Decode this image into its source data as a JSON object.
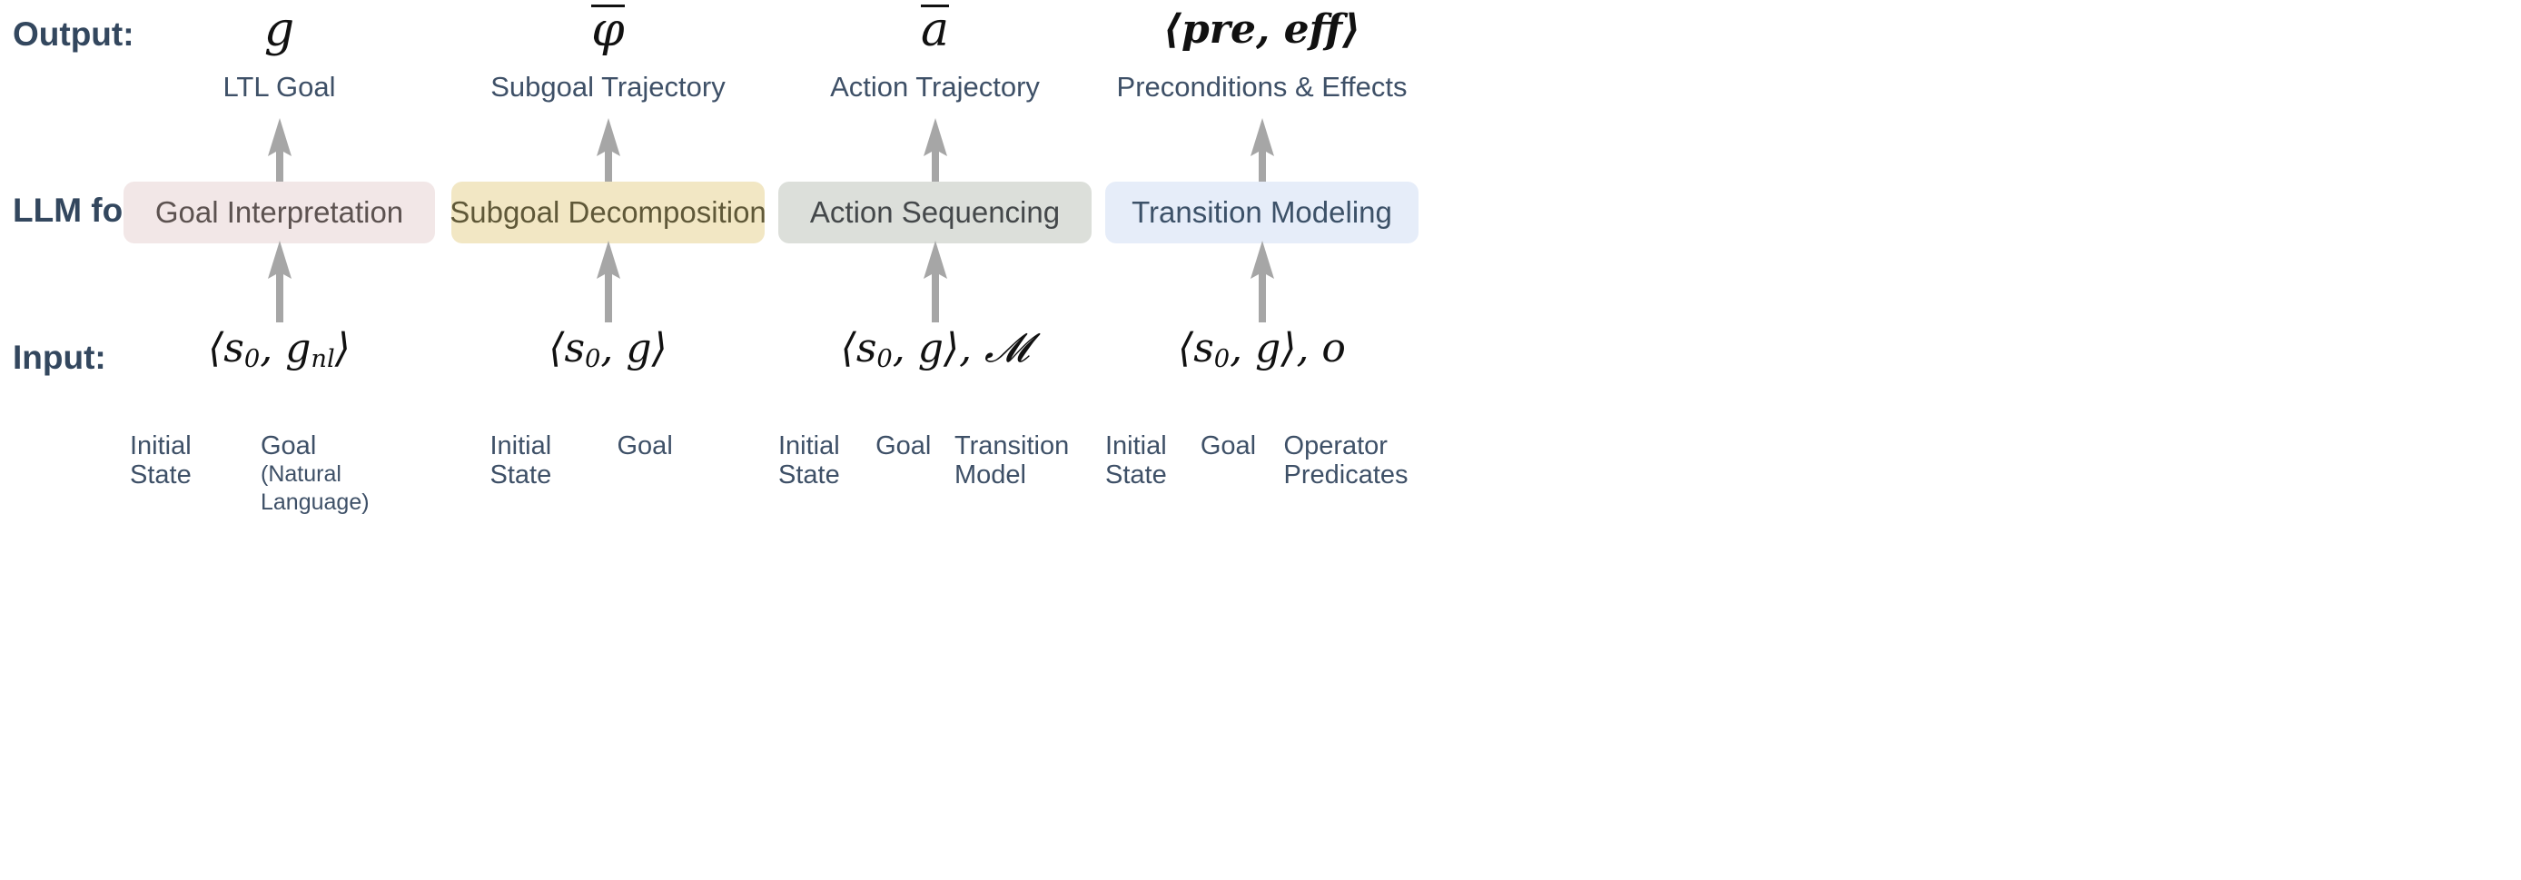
{
  "rows": {
    "output_label": "Output:",
    "llm_label": "LLM for:",
    "input_label": "Input:"
  },
  "colors": {
    "row_label_text": "#33475e",
    "caption_text": "#3e5067",
    "math_text": "#111111",
    "arrow": "#a6a6a6",
    "box_1_bg": "#f2e7e7",
    "box_1_text": "#5c5250",
    "box_2_bg": "#f2e7c4",
    "box_2_text": "#5f5838",
    "box_3_bg": "#dcdfda",
    "box_3_text": "#44484a",
    "box_4_bg": "#e6edf9",
    "box_4_text": "#3c5168"
  },
  "columns": [
    {
      "output_symbol": "g",
      "output_symbol_overbar": false,
      "output_symbol_bold": false,
      "output_caption": "LTL Goal",
      "box_label": "Goal Interpretation",
      "box_bg": "#f2e7e7",
      "box_text_color": "#5c5250",
      "input_symbol": "⟨s₀, g_nl⟩",
      "input_descriptors": [
        {
          "main": "Initial\nState",
          "sub": ""
        },
        {
          "main": "Goal",
          "sub": "(Natural\nLanguage)"
        }
      ]
    },
    {
      "output_symbol": "φ",
      "output_symbol_overbar": true,
      "output_symbol_bold": false,
      "output_caption": "Subgoal Trajectory",
      "box_label": "Subgoal Decomposition",
      "box_bg": "#f2e7c4",
      "box_text_color": "#5f5838",
      "input_symbol": "⟨s₀, g⟩",
      "input_descriptors": [
        {
          "main": "Initial\nState",
          "sub": ""
        },
        {
          "main": "Goal",
          "sub": ""
        }
      ]
    },
    {
      "output_symbol": "a",
      "output_symbol_overbar": true,
      "output_symbol_bold": false,
      "output_caption": "Action Trajectory",
      "box_label": "Action Sequencing",
      "box_bg": "#dcdfda",
      "box_text_color": "#44484a",
      "input_symbol": "⟨s₀, g⟩, 𝓜",
      "input_descriptors": [
        {
          "main": "Initial\nState",
          "sub": ""
        },
        {
          "main": "Goal",
          "sub": ""
        },
        {
          "main": "Transition\nModel",
          "sub": ""
        }
      ]
    },
    {
      "output_symbol": "⟨pre, eff⟩",
      "output_symbol_overbar": false,
      "output_symbol_bold": true,
      "output_caption": "Preconditions & Effects",
      "box_label": "Transition Modeling",
      "box_bg": "#e6edf9",
      "box_text_color": "#3c5168",
      "input_symbol": "⟨s₀, g⟩, o",
      "input_descriptors": [
        {
          "main": "Initial\nState",
          "sub": ""
        },
        {
          "main": "Goal",
          "sub": ""
        },
        {
          "main": "Operator\nPredicates",
          "sub": ""
        }
      ]
    }
  ],
  "icons": {
    "up_arrow": "up-arrow-icon"
  }
}
